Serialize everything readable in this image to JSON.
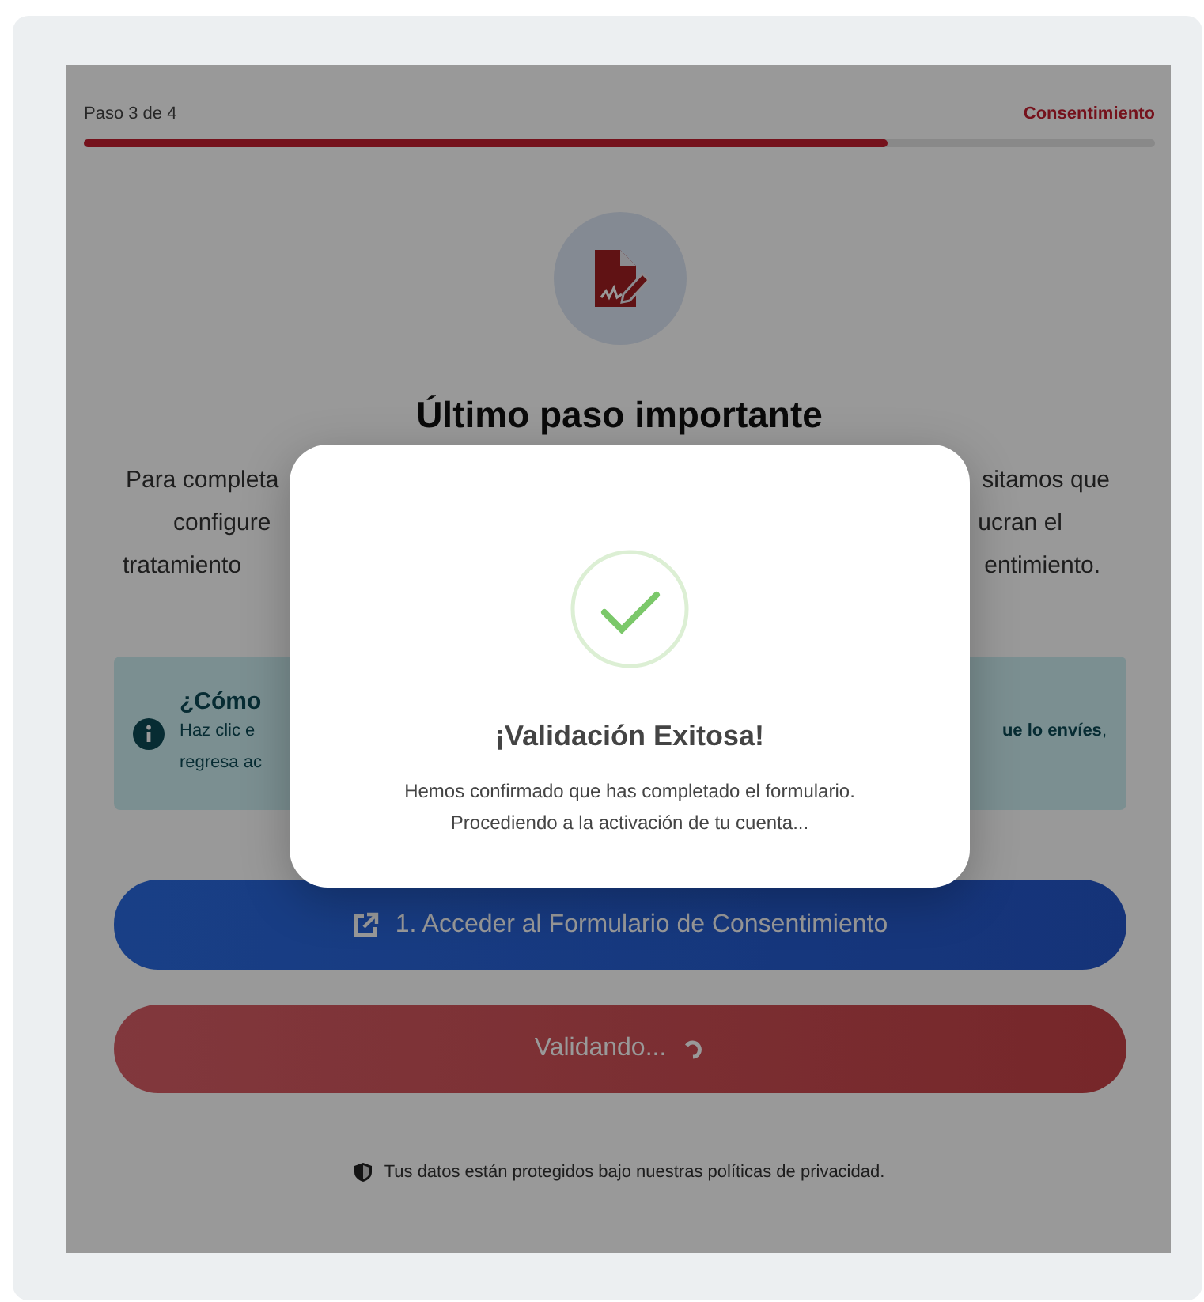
{
  "progress": {
    "step": "Paso 3 de 4",
    "name": "Consentimiento",
    "level": 0.75
  },
  "title": "Último paso importante",
  "intro_lines": [
    {
      "left": "Para completa",
      "right": "sitamos que"
    },
    {
      "left": "configure",
      "right": "ucran el"
    },
    {
      "left": "tratamiento",
      "right": "entimiento."
    }
  ],
  "info": {
    "title": "¿Cómo",
    "lines": [
      {
        "left": "Haz clic e",
        "right": "**ue lo envíes**,"
      },
      {
        "left": "regresa ac"
      }
    ]
  },
  "buttons": [
    {
      "kind": "link",
      "label": "1. Acceder al Formulario de Consentimiento"
    },
    {
      "kind": "loading",
      "label": "Validando..."
    }
  ],
  "footer": "Tus datos están protegidos bajo nuestras políticas de privacidad.",
  "modal": {
    "title": "¡Validación Exitosa!",
    "lines": [
      "Hemos confirmado que has completado el formulario.",
      "Procediendo a la activación de tu cuenta..."
    ]
  }
}
